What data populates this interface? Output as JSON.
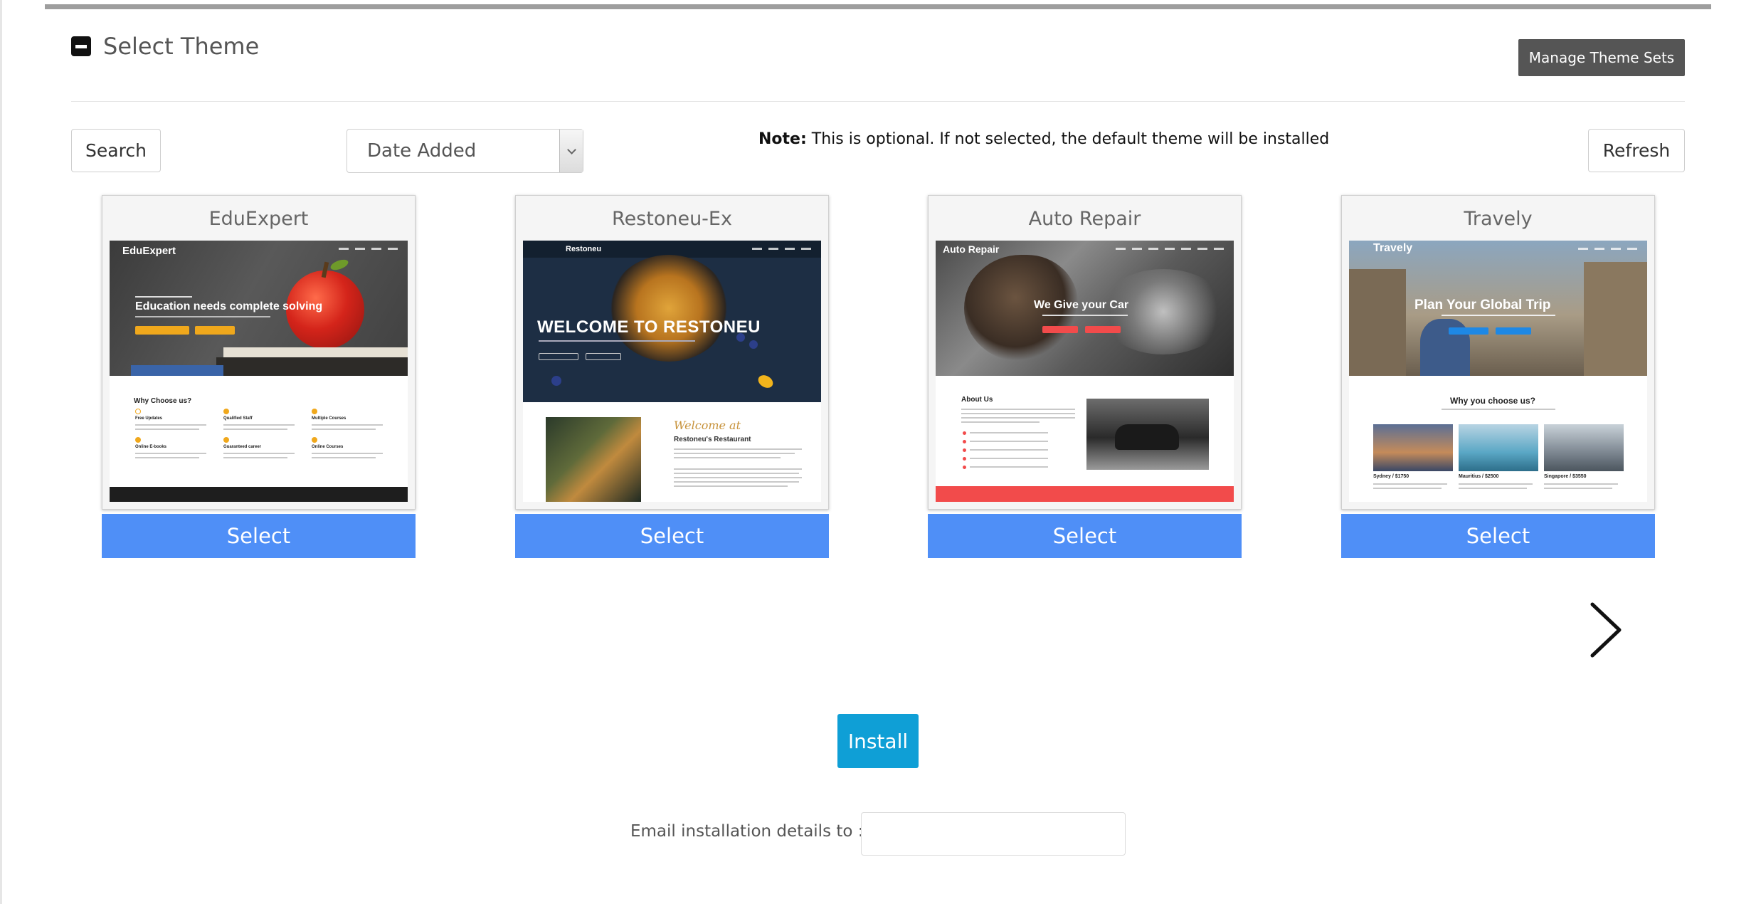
{
  "section": {
    "title": "Select Theme",
    "manage_label": "Manage Theme Sets"
  },
  "toolbar": {
    "search_label": "Search",
    "sort_selected": "Date Added",
    "note_label": "Note:",
    "note_text": " This is optional. If not selected, the default theme will be installed",
    "refresh_label": "Refresh"
  },
  "themes": [
    {
      "name": "EduExpert",
      "select_label": "Select",
      "preview": {
        "brand": "EduExpert",
        "headline": "Education needs complete solving",
        "section_heading": "Why Choose us?",
        "features": [
          "Free Updates",
          "Qualified Staff",
          "Multiple Courses",
          "Online E-books",
          "Guaranteed career",
          "Online Courses"
        ]
      }
    },
    {
      "name": "Restoneu-Ex",
      "select_label": "Select",
      "preview": {
        "brand": "Restoneu",
        "headline": "WELCOME TO RESTONEU",
        "script_heading": "Welcome at",
        "section_heading": "Restoneu's Restaurant"
      }
    },
    {
      "name": "Auto Repair",
      "select_label": "Select",
      "preview": {
        "brand": "Auto Repair",
        "headline": "We Give your Car",
        "section_heading": "About Us"
      }
    },
    {
      "name": "Travely",
      "select_label": "Select",
      "preview": {
        "brand": "Travely",
        "headline": "Plan Your Global Trip",
        "section_heading": "Why you choose us?",
        "destinations": [
          "Sydney / $1750",
          "Mauritius / $2500",
          "Singapore / $3550"
        ]
      }
    }
  ],
  "install": {
    "label": "Install",
    "email_label": "Email installation details to :",
    "email_value": ""
  },
  "icons": {
    "collapse": "minus-square-icon",
    "next": "chevron-right-icon",
    "dropdown": "chevron-down-icon"
  },
  "colors": {
    "select_button": "#4f8ff7",
    "install_button": "#0f9fd6",
    "manage_button": "#555555"
  }
}
